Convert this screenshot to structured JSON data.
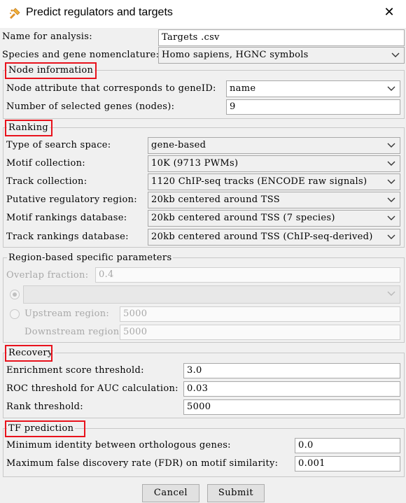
{
  "window": {
    "title": "Predict regulators and targets",
    "close_glyph": "✕"
  },
  "general": {
    "name_label": "Name for analysis:",
    "name_value": "Targets .csv",
    "species_label": "Species and gene nomenclature:",
    "species_value": "Homo sapiens, HGNC symbols"
  },
  "node_information": {
    "title": "Node information",
    "attribute_label": "Node attribute that corresponds to geneID:",
    "attribute_value": "name",
    "selected_label": "Number of selected genes (nodes):",
    "selected_value": "9"
  },
  "ranking": {
    "title": "Ranking",
    "search_space_label": "Type of search space:",
    "search_space_value": "gene-based",
    "motif_collection_label": "Motif collection:",
    "motif_collection_value": "10K (9713 PWMs)",
    "track_collection_label": "Track collection:",
    "track_collection_value": "1120 ChIP-seq tracks (ENCODE raw signals)",
    "putative_region_label": "Putative regulatory region:",
    "putative_region_value": "20kb centered around TSS",
    "motif_db_label": "Motif rankings database:",
    "motif_db_value": "20kb centered around TSS (7 species)",
    "track_db_label": "Track rankings database:",
    "track_db_value": "20kb centered around TSS (ChIP-seq-derived)"
  },
  "region_params": {
    "title": "Region-based specific parameters",
    "overlap_label": "Overlap fraction:",
    "overlap_value": "0.4",
    "upstream_label": "Upstream region:",
    "upstream_value": "5000",
    "downstream_label": "Downstream region:",
    "downstream_value": "5000"
  },
  "recovery": {
    "title": "Recovery",
    "enrichment_label": "Enrichment score threshold:",
    "enrichment_value": "3.0",
    "roc_label": "ROC threshold for AUC calculation:",
    "roc_value": "0.03",
    "rank_label": "Rank threshold:",
    "rank_value": "5000"
  },
  "tf_prediction": {
    "title": "TF prediction",
    "identity_label": "Minimum identity between orthologous genes:",
    "identity_value": "0.0",
    "fdr_label": "Maximum false discovery rate (FDR) on motif similarity:",
    "fdr_value": "0.001"
  },
  "buttons": {
    "cancel": "Cancel",
    "submit": "Submit"
  },
  "colors": {
    "highlight": "#e8121c",
    "window_bg": "#f0f0f0"
  }
}
